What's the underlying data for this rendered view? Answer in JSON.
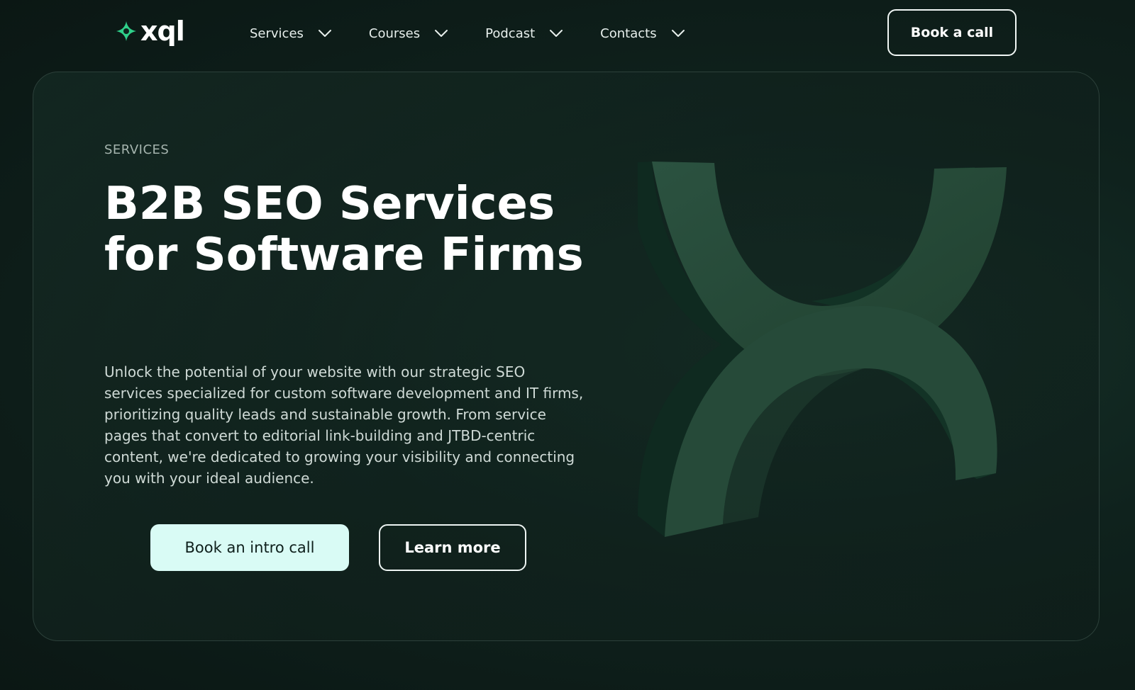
{
  "brand": {
    "name": "xql",
    "accent_color": "#2fd08a"
  },
  "nav": {
    "items": [
      {
        "label": "Services",
        "icon": "chevron-down-icon"
      },
      {
        "label": "Courses",
        "icon": "chevron-down-icon"
      },
      {
        "label": "Podcast",
        "icon": "chevron-down-icon"
      },
      {
        "label": "Contacts",
        "icon": "chevron-down-icon"
      }
    ],
    "cta_label": "Book a call"
  },
  "hero": {
    "eyebrow": "SERVICES",
    "title": "B2B SEO Services for Software Firms",
    "description": "Unlock the potential of your website with our strategic SEO services specialized for custom software development and IT firms, prioritizing quality leads and sustainable growth. From service pages that convert to editorial link-building and JTBD-centric content, we're dedicated to growing your visibility and connecting you with your ideal audience.",
    "primary_button": "Book an intro call",
    "secondary_button": "Learn more",
    "art_icon": "xql-3d-logo-mark",
    "primary_button_color": "#d9fbf5",
    "art_color": "#274a3b"
  }
}
